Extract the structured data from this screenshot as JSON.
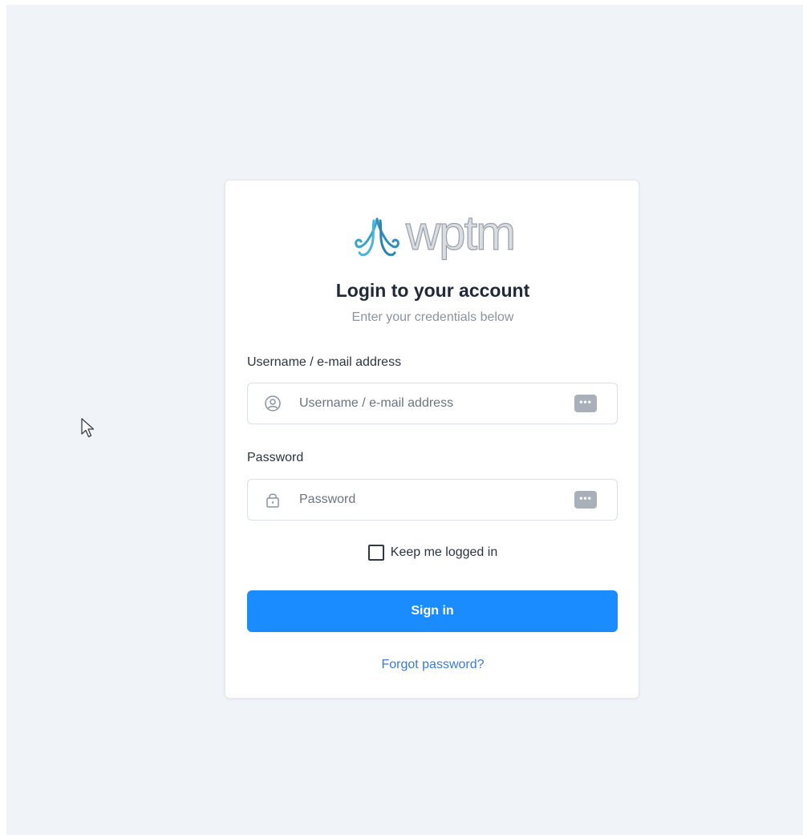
{
  "login": {
    "logo_text": "wptm",
    "title": "Login to your account",
    "subtitle": "Enter your credentials below",
    "username": {
      "label": "Username / e-mail address",
      "placeholder": "Username / e-mail address",
      "value": "",
      "icon": "user-circle-icon"
    },
    "password": {
      "label": "Password",
      "placeholder": "Password",
      "value": "",
      "icon": "lock-icon"
    },
    "password_manager_icon": "password-manager-icon",
    "password_manager_glyph": "•••",
    "remember": {
      "label": "Keep me logged in",
      "checked": false
    },
    "signin_label": "Sign in",
    "forgot_label": "Forgot password?"
  },
  "colors": {
    "background": "#f0f3f7",
    "card": "#ffffff",
    "primary": "#1a8cff",
    "link": "#3a7bd5",
    "logo_accent": "#3aa3c9"
  }
}
